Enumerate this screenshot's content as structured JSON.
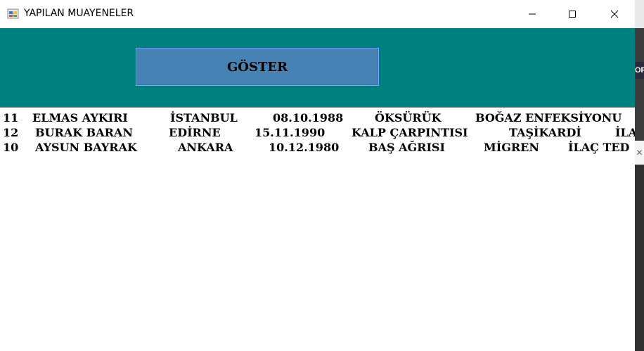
{
  "window": {
    "title": "YAPILAN MUAYENELER",
    "controls": {
      "minimize": "minimize-icon",
      "maximize": "maximize-icon",
      "close": "close-icon"
    }
  },
  "form": {
    "background": "#007f7f",
    "goster_label": "GÖSTER",
    "button_color": "#4682b4"
  },
  "list": {
    "rows": [
      {
        "id": "11",
        "name": "ELMAS AYKIRI",
        "city": "İSTANBUL",
        "date": "08.10.1988",
        "complaint": "ÖKSÜRÜK",
        "diagnosis": "BOĞAZ ENFEKSİYONU",
        "treatment": ""
      },
      {
        "id": "12",
        "name": "BURAK BARAN",
        "city": "EDİRNE",
        "date": "15.11.1990",
        "complaint": "KALP ÇARPINTISI",
        "diagnosis": "TAŞİKARDİ",
        "treatment": "İLA"
      },
      {
        "id": "10",
        "name": "AYSUN BAYRAK",
        "city": "ANKARA",
        "date": "10.12.1980",
        "complaint": "BAŞ AĞRISI",
        "diagnosis": "MİGREN",
        "treatment": "İLAÇ TED"
      }
    ]
  },
  "side": {
    "tab_text": "OF"
  }
}
